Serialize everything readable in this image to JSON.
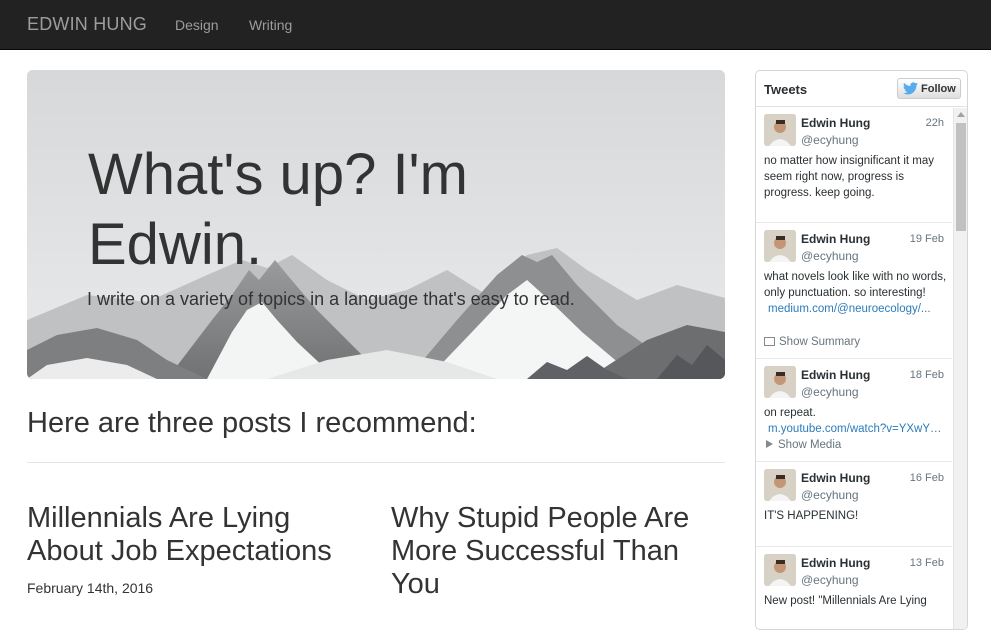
{
  "nav": {
    "brand": "EDWIN HUNG",
    "links": [
      "Design",
      "Writing"
    ]
  },
  "hero": {
    "title": "What's up? I'm Edwin.",
    "subtitle": "I write on a variety of topics in a language that's easy to read."
  },
  "recommend": {
    "heading": "Here are three posts I recommend:",
    "posts": [
      {
        "title": "Millennials Are Lying About Job Expectations",
        "date": "February 14th, 2016"
      },
      {
        "title": "Why Stupid People Are More Successful Than You"
      }
    ]
  },
  "tweets": {
    "title": "Tweets",
    "follow_label": "Follow",
    "items": [
      {
        "name": "Edwin Hung",
        "handle": "@ecyhung",
        "time": "22h",
        "text": "no matter how insignificant it may seem right now,  progress is progress. keep going."
      },
      {
        "name": "Edwin Hung",
        "handle": "@ecyhung",
        "time": "19 Feb",
        "text": "what novels look like with no words, only punctuation. so interesting!",
        "link": "medium.com/@neuroecology/...",
        "extra": "Show Summary"
      },
      {
        "name": "Edwin Hung",
        "handle": "@ecyhung",
        "time": "18 Feb",
        "text": "on repeat.",
        "link": "m.youtube.com/watch?v=YXwYJy...",
        "extra": "Show Media"
      },
      {
        "name": "Edwin Hung",
        "handle": "@ecyhung",
        "time": "16 Feb",
        "text": "IT'S HAPPENING!"
      },
      {
        "name": "Edwin Hung",
        "handle": "@ecyhung",
        "time": "13 Feb",
        "text": "New post! \"Millennials Are Lying"
      }
    ]
  },
  "colors": {
    "navbar": "#222222",
    "nav_text": "#9d9d9d",
    "link": "#2b7bb9",
    "twitter_blue": "#55acee"
  }
}
